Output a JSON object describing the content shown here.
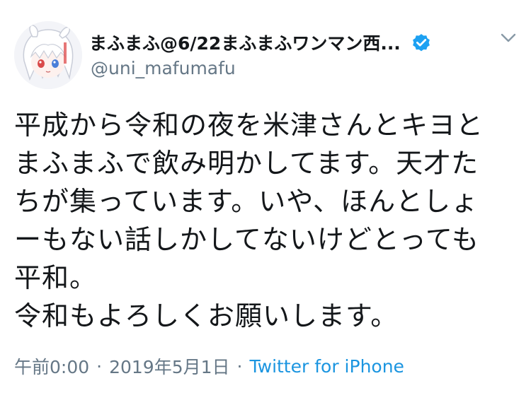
{
  "tweet": {
    "display_name": "まふまふ@6/22まふまふワンマン西...",
    "handle": "@uni_mafumafu",
    "verified": true,
    "text": "平成から令和の夜を米津さんとキヨと\nまふまふで飲み明かしてます。天才た\nちが集っています。いや、ほんとしょ\nーもない話しかしてないけどとっても\n平和。\n令和もよろしくお願いします。",
    "time": "午前0:00",
    "separator": "·",
    "date": "2019年5月1日",
    "source": "Twitter for iPhone"
  },
  "icons": {
    "avatar": "avatar-image",
    "verified": "verified-badge-icon",
    "menu": "chevron-down-icon"
  },
  "colors": {
    "text": "#14171a",
    "secondary": "#657786",
    "link": "#1b95e0",
    "verified": "#1da1f2"
  }
}
